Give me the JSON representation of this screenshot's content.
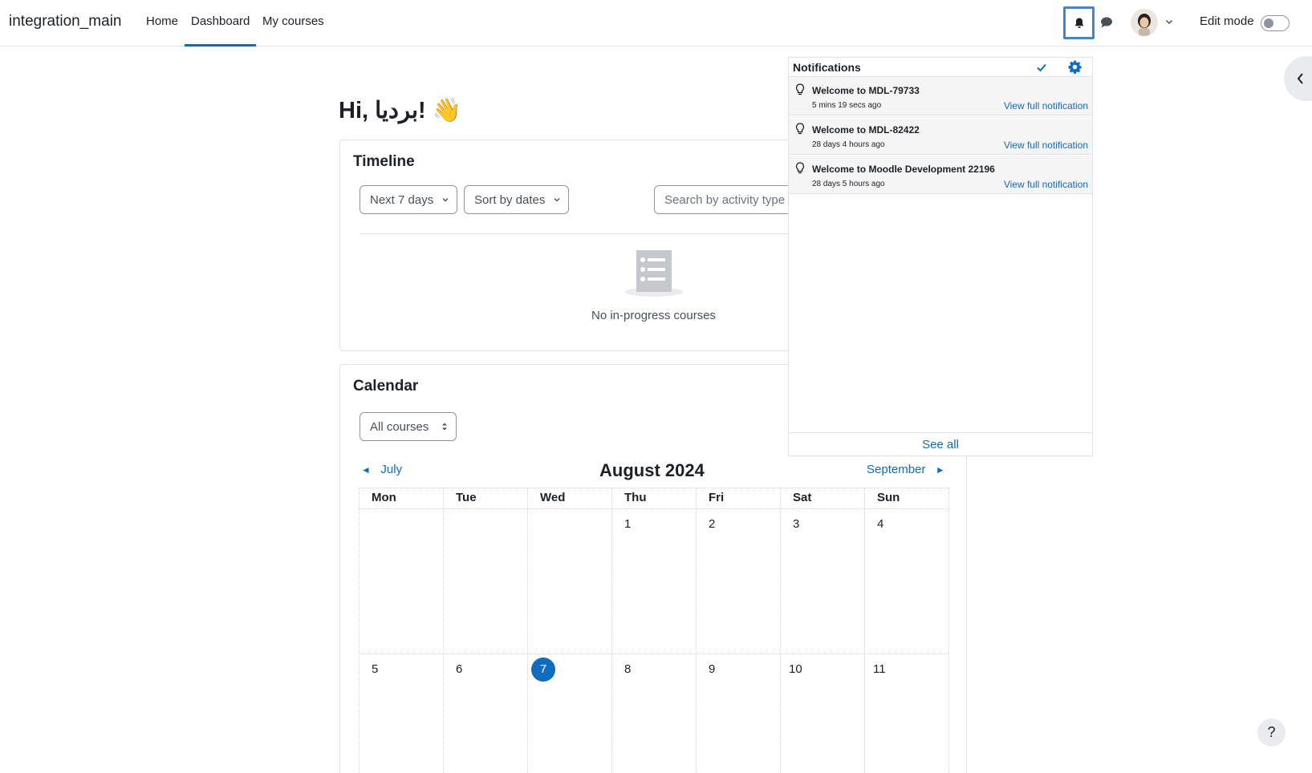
{
  "navbar": {
    "brand": "integration_main",
    "links": [
      {
        "label": "Home"
      },
      {
        "label": "Dashboard"
      },
      {
        "label": "My courses"
      }
    ],
    "edit_mode_label": "Edit mode"
  },
  "greeting": "Hi, برديا! 👋",
  "timeline": {
    "title": "Timeline",
    "filter_label": "Next 7 days",
    "sort_label": "Sort by dates",
    "search_placeholder": "Search by activity type or name",
    "empty_text": "No in-progress courses"
  },
  "calendar": {
    "title": "Calendar",
    "course_select": "All courses",
    "prev_month": "July",
    "next_month": "September",
    "month_title": "August 2024",
    "weekdays": [
      "Mon",
      "Tue",
      "Wed",
      "Thu",
      "Fri",
      "Sat",
      "Sun"
    ],
    "week1": [
      "",
      "",
      "",
      "1",
      "2",
      "3",
      "4"
    ],
    "week2": [
      "5",
      "6",
      "7",
      "8",
      "9",
      "10",
      "11"
    ],
    "today": "7",
    "prev_arrow": "◄",
    "next_arrow": "►"
  },
  "notifications": {
    "title": "Notifications",
    "items": [
      {
        "title": "Welcome to MDL-79733",
        "time": "5 mins 19 secs ago",
        "link": "View full notification"
      },
      {
        "title": "Welcome to MDL-82422",
        "time": "28 days 4 hours ago",
        "link": "View full notification"
      },
      {
        "title": "Welcome to Moodle Development 22196",
        "time": "28 days 5 hours ago",
        "link": "View full notification"
      }
    ],
    "see_all": "See all"
  },
  "help_label": "?",
  "colors": {
    "primary": "#0f6cbf",
    "text": "#1d2125",
    "border": "#dee2e6"
  },
  "icons": [
    "bell-icon",
    "chat-icon",
    "chevron-down-icon",
    "chevron-left-icon",
    "check-icon",
    "gear-icon",
    "lightbulb-icon",
    "list-icon"
  ]
}
